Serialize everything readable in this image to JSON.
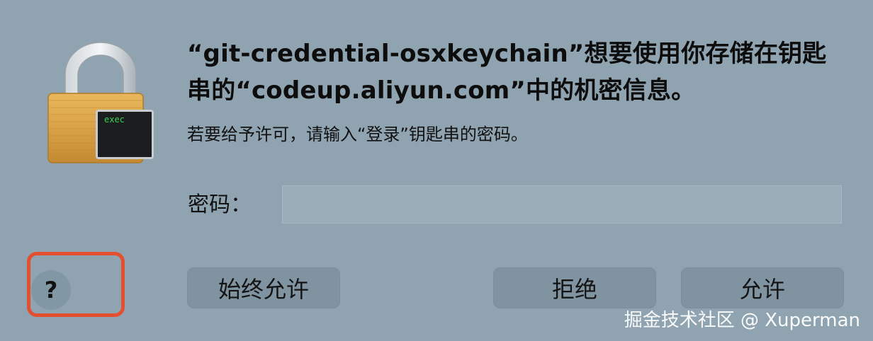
{
  "dialog": {
    "title": "“git-credential-osxkeychain”想要使用你存储在钥匙串的“codeup.aliyun.com”中的机密信息。",
    "subtitle": "若要给予许可，请输入“登录”钥匙串的密码。",
    "exec_label": "exec",
    "password_label": "密码：",
    "password_value": "",
    "buttons": {
      "always_allow": "始终允许",
      "deny": "拒绝",
      "allow": "允许"
    },
    "help_label": "?"
  },
  "watermark": "掘金技术社区 @ Xuperman",
  "icons": {
    "lock": "lock-icon",
    "exec_terminal": "terminal-icon"
  },
  "colors": {
    "background": "#8fa3b0",
    "highlight": "#e4502f",
    "terminal_text": "#39d353"
  }
}
